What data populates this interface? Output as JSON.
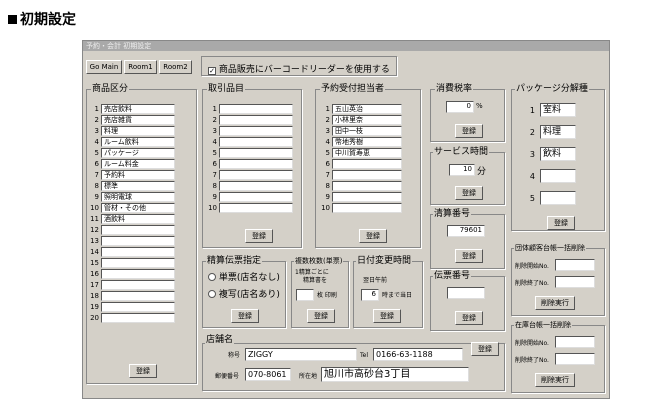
{
  "page": {
    "heading": "初期設定"
  },
  "window": {
    "title": "予約・会計  初期設定"
  },
  "toolbar": {
    "go_main": "Go Main",
    "room1": "Room1",
    "room2": "Room2",
    "barcode_label": "商品販売にバーコードリーダーを使用する",
    "barcode_checked": "✓"
  },
  "product_category": {
    "title": "商品区分",
    "items": [
      "売店飲料",
      "売店雑貨",
      "料理",
      "ルーム飲料",
      "パッケージ",
      "ルーム料金",
      "予約料",
      "標準",
      "照明電球",
      "管材・その他",
      "酒飲料",
      "",
      "",
      "",
      "",
      "",
      "",
      "",
      "",
      ""
    ],
    "register": "登録"
  },
  "trade_items": {
    "title": "取引品目",
    "items": [
      "",
      "",
      "",
      "",
      "",
      "",
      "",
      "",
      "",
      ""
    ],
    "register": "登録"
  },
  "reservation_staff": {
    "title": "予約受付担当者",
    "items": [
      "五山英治",
      "小林里奈",
      "田中一枝",
      "幣地秀樹",
      "中川賀寿恵",
      "",
      "",
      "",
      "",
      ""
    ],
    "register": "登録"
  },
  "tax": {
    "title": "消費税率",
    "value": "0",
    "unit": "%",
    "register": "登録"
  },
  "service_time": {
    "title": "サービス時間",
    "value": "10",
    "unit": "分",
    "register": "登録"
  },
  "settlement_no": {
    "title": "清算番号",
    "value": "79601",
    "register": "登録"
  },
  "slip_no": {
    "title": "伝票番号",
    "value": "",
    "register": "登録"
  },
  "package": {
    "title": "パッケージ分解種",
    "items": [
      "室料",
      "料理",
      "飲料",
      "",
      ""
    ],
    "register": "登録"
  },
  "slip_setting": {
    "title": "精算伝票指定",
    "opt1": "単票(店名なし)",
    "opt2": "複写(店名あり)",
    "register": "登録"
  },
  "print_count": {
    "title": "複数枚数(単票)",
    "note1": "1精算ごとに",
    "note2": "精算書を",
    "value": "",
    "unit": "枚 印刷",
    "register": "登録"
  },
  "date_change": {
    "title": "日付変更時間",
    "note": "翌日午前",
    "value": "6",
    "unit": "時まで当日",
    "register": "登録"
  },
  "shop": {
    "title": "店舗名",
    "name_label": "称号",
    "name": "ZIGGY",
    "tel_label": "Tel",
    "tel": "0166-63-1188",
    "zip_label": "郵便番号",
    "zip": "070-8061",
    "addr_label": "所在地",
    "addr": "旭川市高砂台3丁目",
    "register": "登録"
  },
  "group_delete": {
    "title": "団体顧客台帳一括削除",
    "start_label": "削除開始No.",
    "end_label": "削除終了No.",
    "start": "",
    "end": "",
    "run": "削除実行"
  },
  "stock_delete": {
    "title": "在庫台帳一括削除",
    "start_label": "削除開始No.",
    "end_label": "削除終了No.",
    "start": "",
    "end": "",
    "run": "削除実行"
  }
}
